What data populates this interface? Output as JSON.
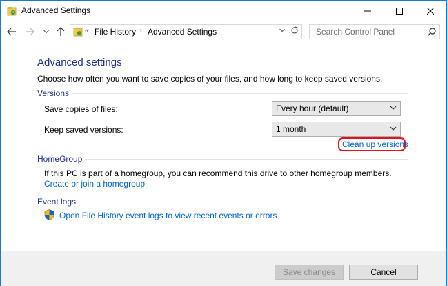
{
  "window": {
    "title": "Advanced Settings"
  },
  "nav": {
    "breadcrumb": [
      "File History",
      "Advanced Settings"
    ],
    "addr_prefix": "«",
    "search_placeholder": "Search Control Panel"
  },
  "main": {
    "heading": "Advanced settings",
    "description": "Choose how often you want to save copies of your files, and how long to keep saved versions.",
    "versions": {
      "title": "Versions",
      "save_copies_label": "Save copies of files:",
      "save_copies_value": "Every hour (default)",
      "keep_label": "Keep saved versions:",
      "keep_value": "1 month",
      "cleanup_link": "Clean up versions"
    },
    "homegroup": {
      "title": "HomeGroup",
      "text": "If this PC is part of a homegroup, you can recommend this drive to other homegroup members.",
      "link": "Create or join a homegroup"
    },
    "eventlogs": {
      "title": "Event logs",
      "link": "Open File History event logs to view recent events or errors"
    }
  },
  "footer": {
    "save_label": "Save changes",
    "cancel_label": "Cancel"
  },
  "colors": {
    "link": "#0066cc",
    "heading": "#1e3287",
    "highlight": "#e0121d"
  }
}
